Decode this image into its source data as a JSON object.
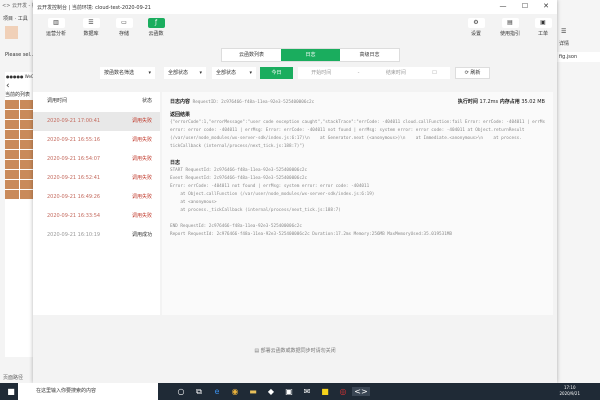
{
  "background_window": {
    "title": "<> 云开发 - 微信开发者工具",
    "menu": "项目 · 工具",
    "project": "Please sel...",
    "phone_header": "●●●●● WeChat",
    "phone_title": "当前的列表",
    "status": "页面路径"
  },
  "window": {
    "title": "云开发控制台 | 当前环境: cloud-test-2020-09-21",
    "minimize": "—",
    "maximize": "☐",
    "close": "✕"
  },
  "toolbar": [
    {
      "label": "运营分析",
      "icon": "chart-icon"
    },
    {
      "label": "数据库",
      "icon": "database-icon"
    },
    {
      "label": "存储",
      "icon": "storage-icon"
    },
    {
      "label": "云函数",
      "icon": "function-icon",
      "active": true
    }
  ],
  "toolbar_right": [
    {
      "label": "设置",
      "icon": "gear-icon"
    },
    {
      "label": "使用指引",
      "icon": "guide-icon"
    },
    {
      "label": "工单",
      "icon": "ticket-icon"
    }
  ],
  "right_window": {
    "menu_label": "详情",
    "file": "fig.json"
  },
  "tabs": [
    {
      "label": "云函数列表"
    },
    {
      "label": "日志",
      "active": true
    },
    {
      "label": "高级日志"
    }
  ],
  "filters": {
    "function": "按函数名筛选",
    "type": "全部状态",
    "status": "全部状态",
    "today": "今日",
    "start": "开始时间",
    "end": "结束时间",
    "refresh": "刷新"
  },
  "list": {
    "col_time": "调用时间",
    "col_status": "状态",
    "rows": [
      {
        "time": "2020-09-21 17:00:41",
        "status": "调用失败",
        "ok": false
      },
      {
        "time": "2020-09-21 16:55:16",
        "status": "调用失败",
        "ok": false
      },
      {
        "time": "2020-09-21 16:54:07",
        "status": "调用失败",
        "ok": false
      },
      {
        "time": "2020-09-21 16:52:41",
        "status": "调用失败",
        "ok": false
      },
      {
        "time": "2020-09-21 16:49:26",
        "status": "调用失败",
        "ok": false
      },
      {
        "time": "2020-09-21 16:33:54",
        "status": "调用失败",
        "ok": false
      },
      {
        "time": "2020-09-21 16:10:19",
        "status": "调用成功",
        "ok": true
      }
    ]
  },
  "detail": {
    "log_label": "日志内容",
    "request_id": "RequestID: 2c976466-f48a-11ea-92e3-525400006c2c",
    "exec_label": "执行时间",
    "exec_time": "17.2ms",
    "mem_label": "内存占用",
    "mem": "35.02 MB",
    "result_label": "返回结果",
    "result_lines": [
      "{\"errorCode\":1,\"errorMessage\":\"user code exception caught\",\"stackTrace\":\"errCode: -404011 cloud.callFunction:fail Error: errCode: -404011 | errMsg: system",
      "error: error code: -404011 | errMsg: Error: errCode: -404011 not found | errMsg: system error: error code: -404011 at Object.returnResult",
      "(/var/user/node_modules/wx-server-sdk/index.js:6:17)\\n    at Generator.next (<anonymous>)\\n    at Immediate.<anonymous>\\n    at process.",
      "tickCallback (internal/process/next_tick.js:188:7)\"}"
    ],
    "log_label2": "日志",
    "log_lines": [
      "START RequestId: 2c976466-f48a-11ea-92e3-525400006c2c",
      "Event RequestId: 2c976466-f48a-11ea-92e3-525400006c2c",
      "Error: errCode: -404011 not found | errMsg: system error: error code: -404011",
      "    at Object.callFunction (/var/user/node_modules/wx-server-sdk/index.js:6:19)",
      "    at <anonymous>",
      "    at process._tickCallback (internal/process/next_tick.js:188:7)",
      "",
      "END RequestId: 2c976466-f48a-11ea-92e3-525400006c2c",
      "Report RequestId: 2c976466-f48a-11ea-92e3-525400006c2c Duration:17.2ms Memory:256MB MaxMemoryUsed:35.019531MB"
    ]
  },
  "footer": "部署云函数或数据同步时请勿关闭",
  "taskbar": {
    "search": "在这里输入你要搜索的内容",
    "time": "17:10",
    "date": "2020/9/21"
  }
}
